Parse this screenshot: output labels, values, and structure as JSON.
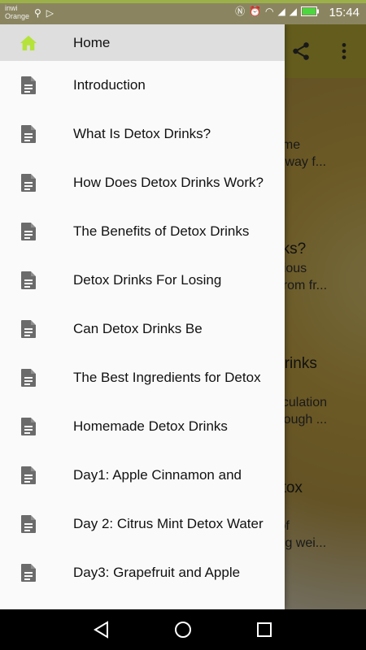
{
  "status_bar": {
    "carrier_line1": "inwi",
    "carrier_line2": "Orange",
    "time": "15:44"
  },
  "background": {
    "lines": [
      {
        "text": "come",
        "heading": false
      },
      {
        "text": "ck way f...",
        "heading": false
      },
      {
        "text": "nks?",
        "heading": true
      },
      {
        "text": "tritious",
        "heading": false
      },
      {
        "text": "d from fr...",
        "heading": false
      },
      {
        "text": "Drinks",
        "heading": true
      },
      {
        "text": "circulation",
        "heading": false
      },
      {
        "text": "through ...",
        "heading": false
      },
      {
        "text": "etox",
        "heading": true
      },
      {
        "text": "s of",
        "heading": false
      },
      {
        "text": "sing wei...",
        "heading": false
      }
    ]
  },
  "drawer": {
    "items": [
      {
        "label": "Home",
        "icon": "home-icon",
        "active": true
      },
      {
        "label": "Introduction",
        "icon": "document-icon"
      },
      {
        "label": "What Is Detox Drinks?",
        "icon": "document-icon"
      },
      {
        "label": "How Does Detox Drinks Work?",
        "icon": "document-icon"
      },
      {
        "label": "The Benefits of Detox Drinks",
        "icon": "document-icon"
      },
      {
        "label": "Detox Drinks For Losing",
        "icon": "document-icon"
      },
      {
        "label": "Can Detox Drinks Be",
        "icon": "document-icon"
      },
      {
        "label": "The Best Ingredients for Detox",
        "icon": "document-icon"
      },
      {
        "label": "Homemade Detox Drinks",
        "icon": "document-icon"
      },
      {
        "label": "Day1: Apple Cinnamon and",
        "icon": "document-icon"
      },
      {
        "label": "Day 2: Citrus Mint Detox Water",
        "icon": "document-icon"
      },
      {
        "label": "Day3: Grapefruit and Apple",
        "icon": "document-icon"
      }
    ]
  },
  "colors": {
    "home_icon": "#b5e33a",
    "drawer_bg": "#fafafa",
    "active_item_bg": "#dedede",
    "doc_icon": "#6b6b6b"
  }
}
